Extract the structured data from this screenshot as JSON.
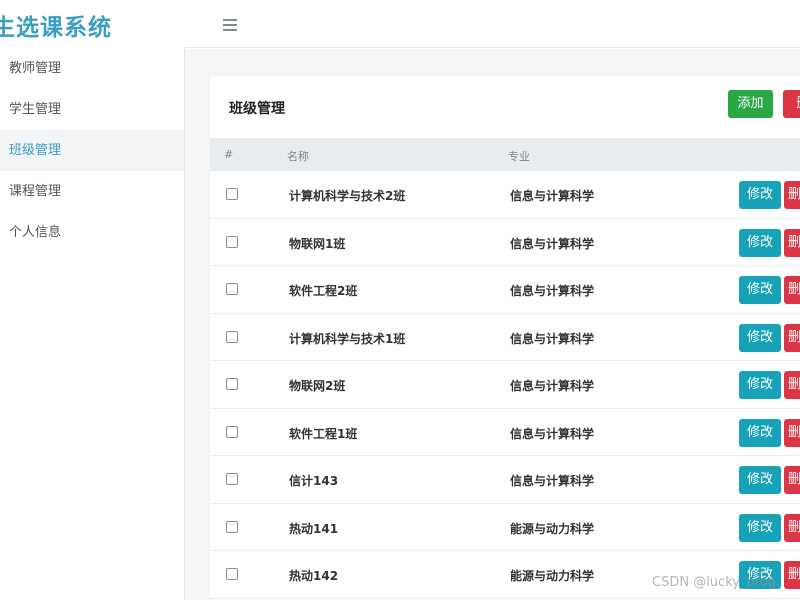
{
  "app": {
    "title": "生选课系统"
  },
  "sidebar": {
    "items": [
      {
        "label": "教师管理",
        "active": false
      },
      {
        "label": "学生管理",
        "active": false
      },
      {
        "label": "班级管理",
        "active": true
      },
      {
        "label": "课程管理",
        "active": false
      },
      {
        "label": "个人信息",
        "active": false
      }
    ]
  },
  "page": {
    "title": "班级管理",
    "add_label": "添加",
    "delete_label": "删"
  },
  "table": {
    "headers": {
      "index": "#",
      "name": "名称",
      "major": "专业"
    },
    "edit_label": "修改",
    "delete_label": "删",
    "rows": [
      {
        "name": "计算机科学与技术2班",
        "major": "信息与计算科学"
      },
      {
        "name": "物联网1班",
        "major": "信息与计算科学"
      },
      {
        "name": "软件工程2班",
        "major": "信息与计算科学"
      },
      {
        "name": "计算机科学与技术1班",
        "major": "信息与计算科学"
      },
      {
        "name": "物联网2班",
        "major": "信息与计算科学"
      },
      {
        "name": "软件工程1班",
        "major": "信息与计算科学"
      },
      {
        "name": "信计143",
        "major": "信息与计算科学"
      },
      {
        "name": "热动141",
        "major": "能源与动力科学"
      },
      {
        "name": "热动142",
        "major": "能源与动力科学"
      }
    ]
  },
  "watermark": "CSDN @lucky_prog",
  "colors": {
    "brand": "#3a9ec3",
    "add": "#28a745",
    "edit": "#17a2b8",
    "delete": "#dc3545"
  },
  "icons": {
    "menu_toggle": "hamburger-icon"
  }
}
